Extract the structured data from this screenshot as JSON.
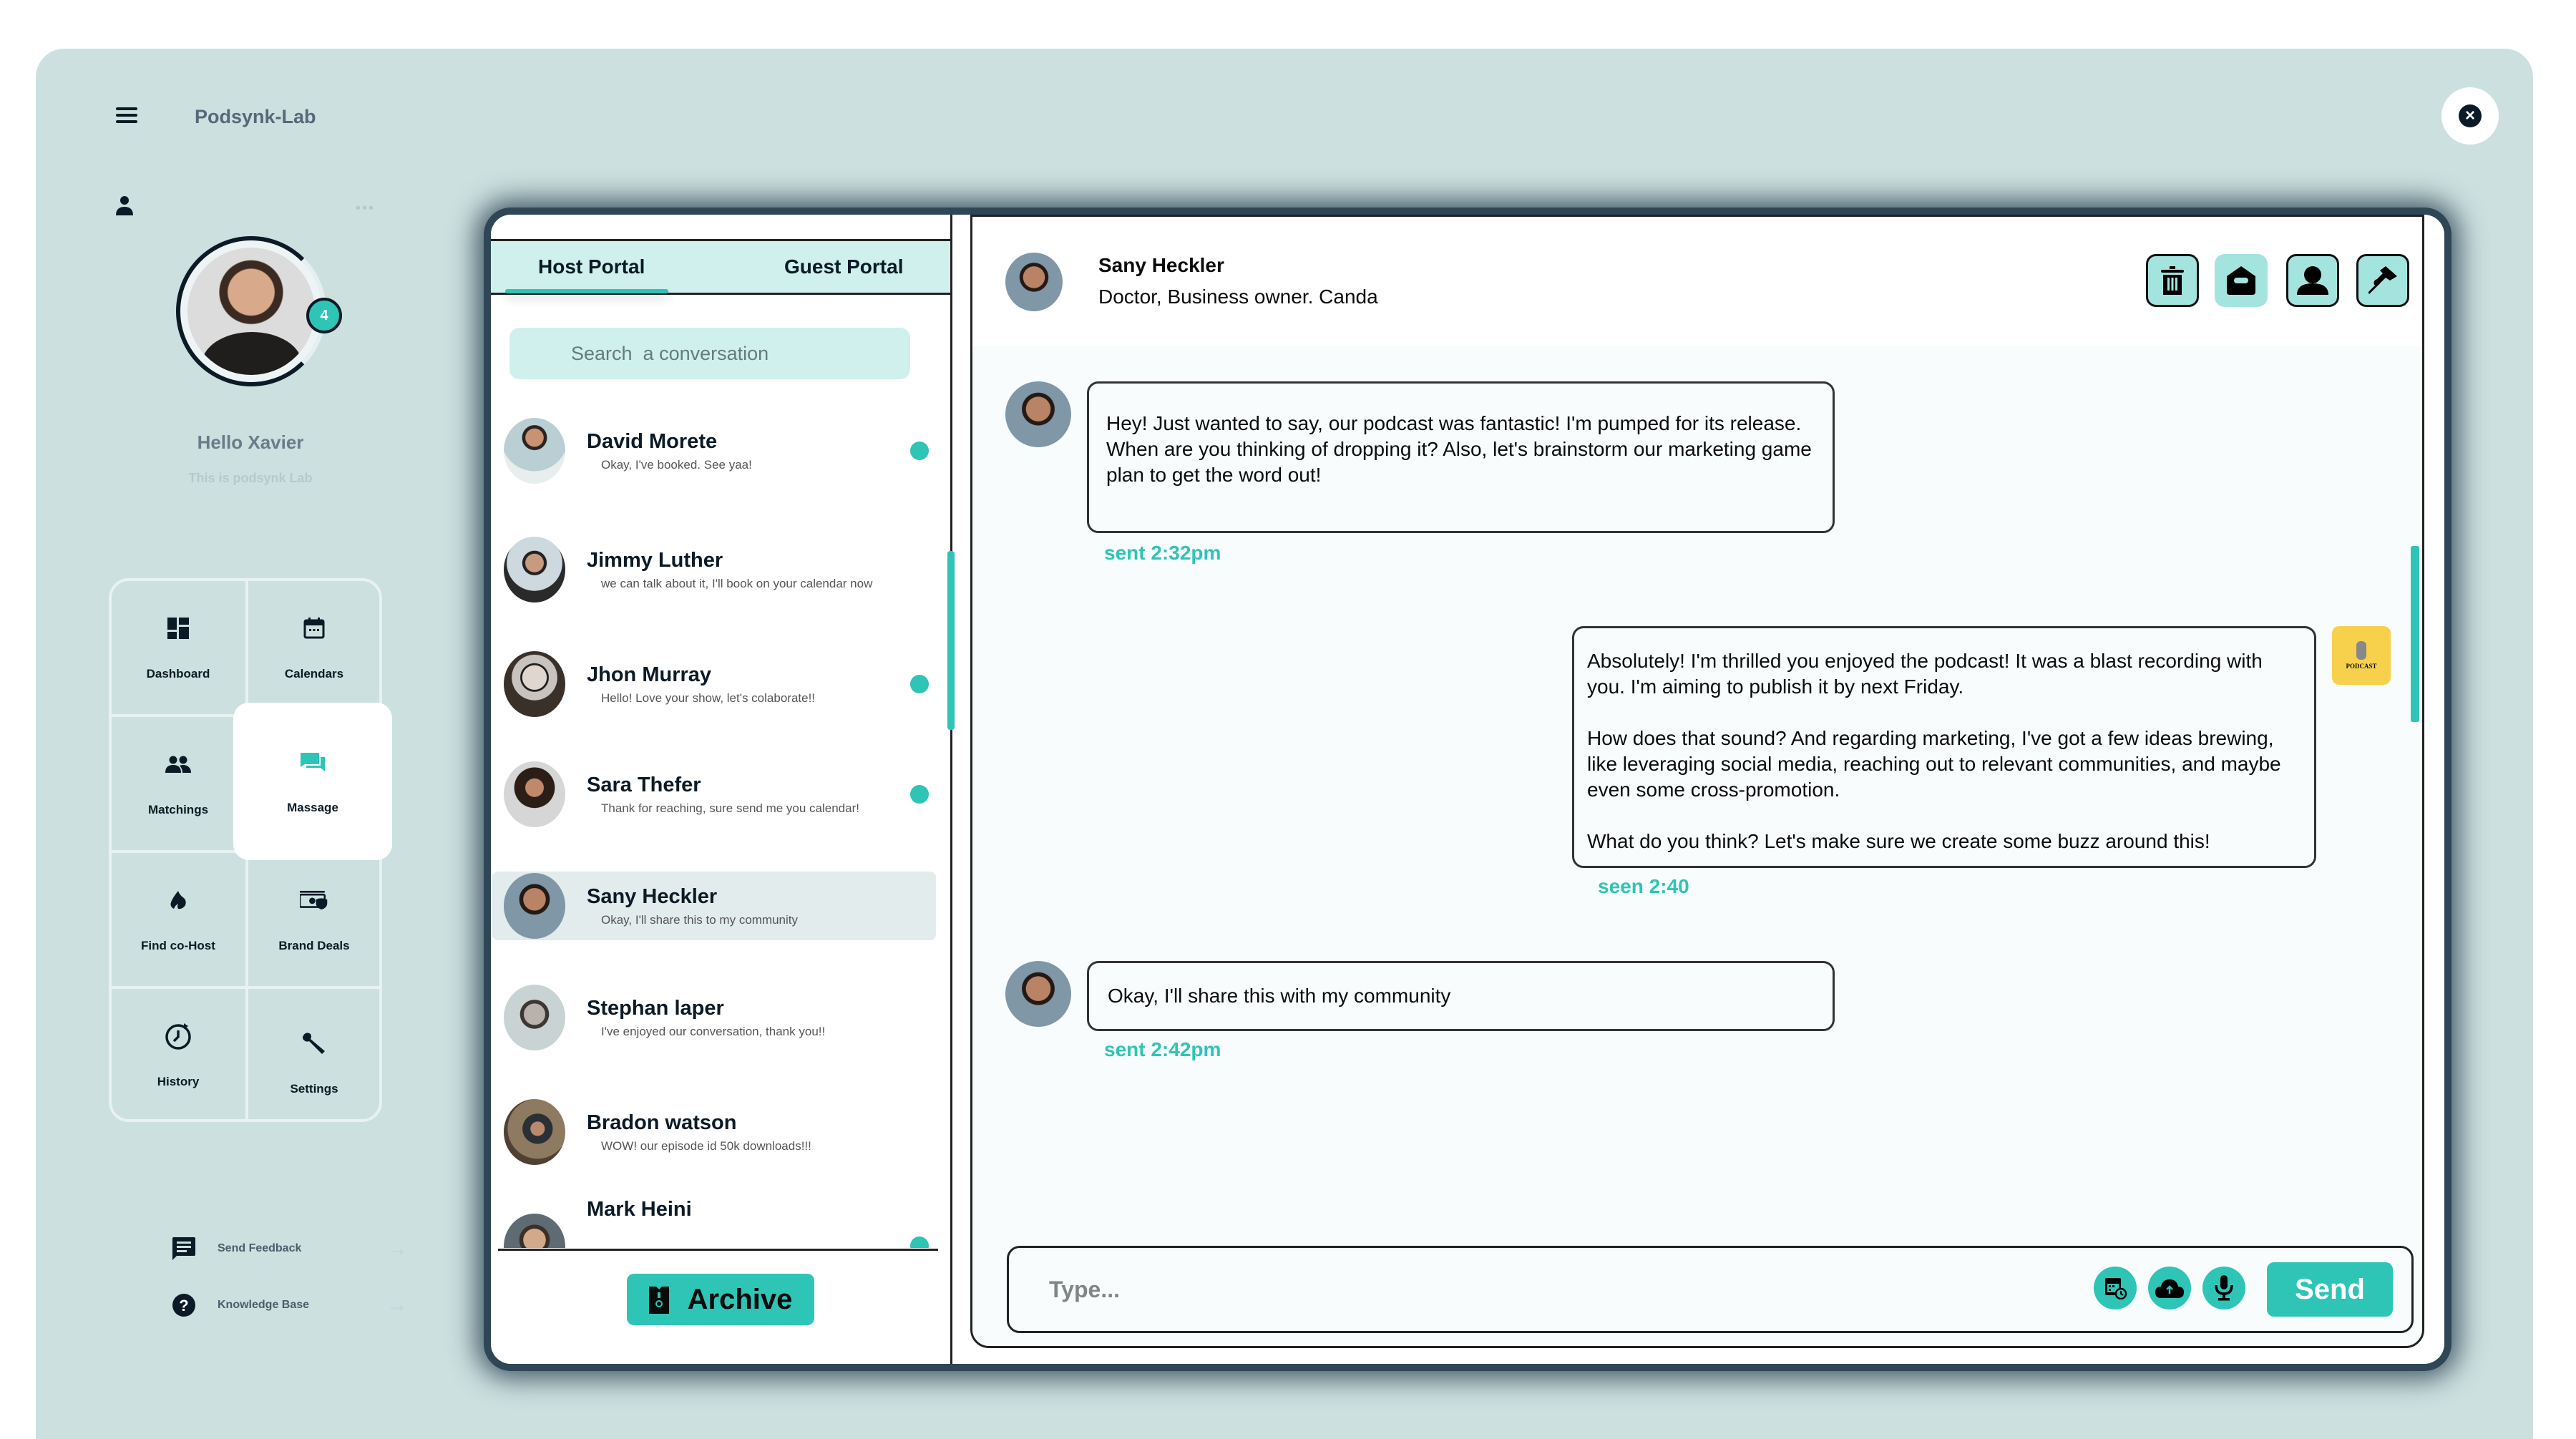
{
  "app": {
    "brand": "Podsynk-Lab",
    "accent_color": "#2ec4b6",
    "background_color": "#cce0df"
  },
  "profile": {
    "greeting": "Hello Xavier",
    "tagline": "This is podsynk Lab",
    "notification_count": "4"
  },
  "nav": {
    "items": [
      {
        "label": "Dashboard",
        "icon": "dashboard-icon"
      },
      {
        "label": "Calendars",
        "icon": "calendar-icon"
      },
      {
        "label": "Matchings",
        "icon": "people-icon"
      },
      {
        "label": "Massage",
        "icon": "chat-icon",
        "active": true
      },
      {
        "label": "Find co-Host",
        "icon": "fire-icon"
      },
      {
        "label": "Brand Deals",
        "icon": "money-shield-icon"
      },
      {
        "label": "History",
        "icon": "history-icon"
      },
      {
        "label": "Settings",
        "icon": "wrench-icon"
      }
    ],
    "footer": [
      {
        "label": "Send Feedback",
        "icon": "feedback-icon"
      },
      {
        "label": "Knowledge  Base",
        "icon": "help-icon"
      }
    ]
  },
  "list": {
    "tabs": [
      {
        "label": "Host Portal",
        "active": true
      },
      {
        "label": "Guest Portal",
        "active": false
      }
    ],
    "search_placeholder": "Search  a conversation",
    "conversations": [
      {
        "name": "David Morete",
        "preview": "Okay, I've booked. See yaa!",
        "unread": true
      },
      {
        "name": "Jimmy Luther",
        "preview": "we can talk about it,  I'll book on your calendar now",
        "unread": false
      },
      {
        "name": "Jhon Murray",
        "preview": "Hello! Love your show, let's colaborate!!",
        "unread": true
      },
      {
        "name": "Sara Thefer",
        "preview": "Thank for reaching, sure send me you calendar!",
        "unread": true
      },
      {
        "name": "Sany Heckler",
        "preview": "Okay, I'll share this to my community",
        "unread": false,
        "selected": true
      },
      {
        "name": "Stephan laper",
        "preview": "I've enjoyed our conversation, thank you!!",
        "unread": false
      },
      {
        "name": "Bradon watson",
        "preview": "WOW! our episode id 50k downloads!!!",
        "unread": false
      },
      {
        "name": "Mark Heini",
        "preview": "",
        "unread": true
      }
    ],
    "archive_label": "Archive"
  },
  "chat": {
    "contact_name": "Sany Heckler",
    "contact_role": "Doctor, Business owner. Canda",
    "header_actions": [
      {
        "name": "delete",
        "icon": "trash-icon"
      },
      {
        "name": "mark-read",
        "icon": "open-envelope-icon"
      },
      {
        "name": "profile",
        "icon": "person-icon"
      },
      {
        "name": "pin",
        "icon": "pin-icon"
      }
    ],
    "messages": [
      {
        "from": "contact",
        "text": "Hey! Just wanted to say, our podcast was fantastic! I'm pumped for its release. When are you thinking of dropping it? Also, let's brainstorm our marketing game plan to get the word out!",
        "meta": "sent 2:32pm"
      },
      {
        "from": "me",
        "text": "Absolutely! I'm thrilled you enjoyed the podcast! It was a blast recording with you. I'm aiming to publish it by next Friday.\n\nHow does that sound? And regarding marketing, I've got a few ideas brewing, like leveraging social media, reaching out to relevant communities, and maybe even some cross-promotion.\n\nWhat do you think? Let's make sure we create some buzz around this!",
        "meta": "seen 2:40",
        "attachment_label": "PODCAST"
      },
      {
        "from": "contact",
        "text": "Okay, I'll share this with my community",
        "meta": "sent 2:42pm"
      }
    ],
    "compose": {
      "placeholder": "Type...",
      "value": "",
      "send_label": "Send",
      "tools": [
        "schedule-icon",
        "cloud-upload-icon",
        "microphone-icon"
      ]
    }
  }
}
